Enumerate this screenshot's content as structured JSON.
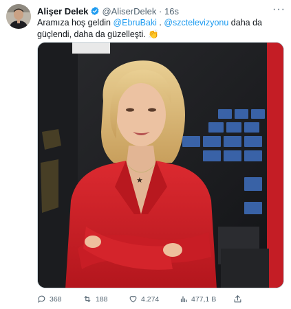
{
  "author": {
    "name": "Alişer Delek",
    "handle": "@AliserDelek",
    "separator": "·",
    "time": "16s"
  },
  "more_label": "···",
  "tweet": {
    "text_part1": "Aramıza hoş geldin ",
    "mention1": "@EbruBaki",
    "text_part2": " . ",
    "mention2": "@szctelevizyonu",
    "text_part3": " daha da güçlendi, daha da güzelleşti. ",
    "emoji": "👏"
  },
  "actions": {
    "replies": "368",
    "retweets": "188",
    "likes": "4.274",
    "views": "477,1 B"
  },
  "colors": {
    "accent": "#1d9bf0",
    "text": "#0f1419",
    "secondary": "#536471",
    "jacket_red": "#d11f27"
  },
  "icons": [
    "verified-badge-icon",
    "more-icon",
    "reply-icon",
    "retweet-icon",
    "like-icon",
    "views-icon",
    "share-icon"
  ]
}
